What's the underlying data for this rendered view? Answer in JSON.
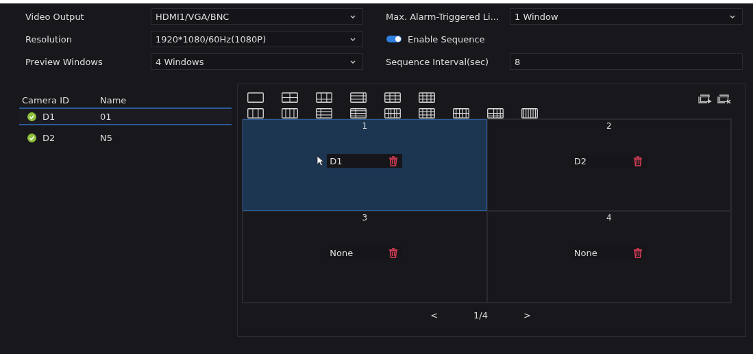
{
  "settings_left": [
    {
      "label": "Video Output",
      "kind": "select",
      "value": "HDMI1/VGA/BNC"
    },
    {
      "label": "Resolution",
      "kind": "select",
      "value": "1920*1080/60Hz(1080P)"
    },
    {
      "label": "Preview Windows",
      "kind": "select",
      "value": "4 Windows"
    }
  ],
  "settings_right": [
    {
      "label": "Max. Alarm-Triggered Li...",
      "kind": "select",
      "value": "1 Window"
    },
    {
      "label": "Enable Sequence",
      "kind": "toggle",
      "on": true
    },
    {
      "label": "Sequence Interval(sec)",
      "kind": "field",
      "value": "8"
    }
  ],
  "camera_list": {
    "columns": [
      "Camera ID",
      "Name"
    ],
    "rows": [
      {
        "id": "D1",
        "name": "01",
        "online": true,
        "selected": true
      },
      {
        "id": "D2",
        "name": "N5",
        "online": true,
        "selected": false
      }
    ]
  },
  "windows": [
    {
      "number": "1",
      "camera": "D1",
      "selected": true
    },
    {
      "number": "2",
      "camera": "D2",
      "selected": false
    },
    {
      "number": "3",
      "camera": "None",
      "selected": false
    },
    {
      "number": "4",
      "camera": "None",
      "selected": false
    }
  ],
  "pagination": {
    "previous": "<",
    "page": "1/4",
    "next": ">"
  }
}
